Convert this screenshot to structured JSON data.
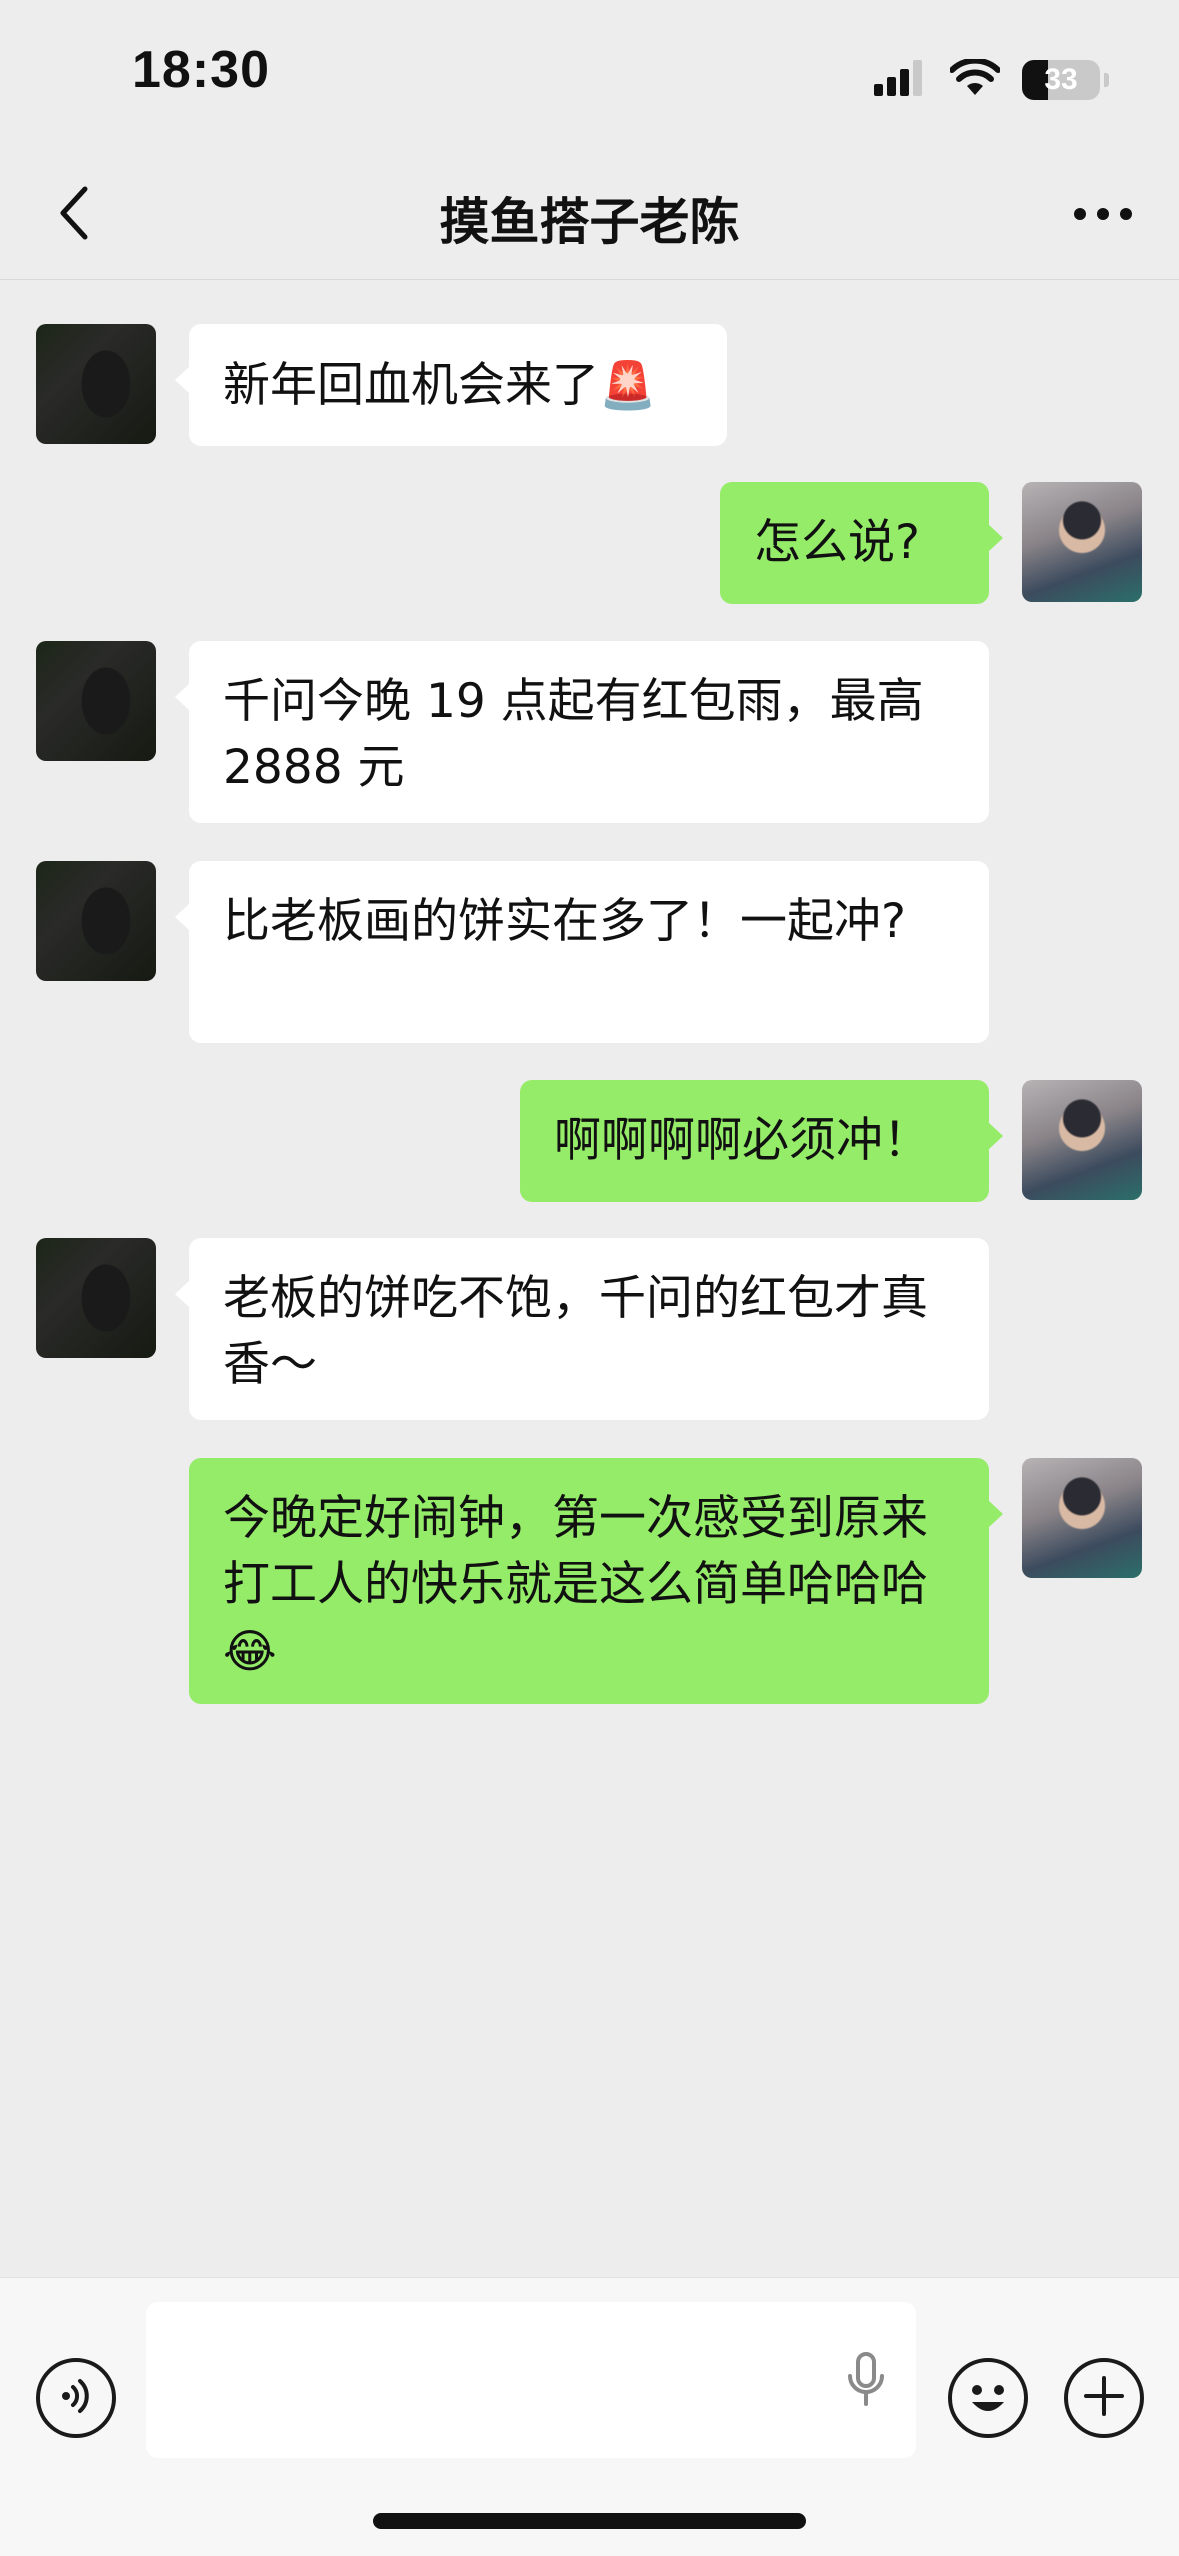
{
  "status_bar": {
    "time": "18:30",
    "battery_level": "33",
    "battery_fraction": 0.33,
    "icons": [
      "cellular-signal-icon",
      "wifi-icon",
      "battery-icon"
    ]
  },
  "nav": {
    "title": "摸鱼搭子老陈",
    "back_icon": "chevron-left-icon",
    "more_icon": "ellipsis-icon"
  },
  "messages": [
    {
      "side": "in",
      "text": "新年回血机会来了",
      "emoji": "🚨"
    },
    {
      "side": "out",
      "text": "怎么说?"
    },
    {
      "side": "in",
      "text": "千问今晚 19 点起有红包雨，最高 2888 元"
    },
    {
      "side": "in",
      "text": "比老板画的饼实在多了！一起冲?"
    },
    {
      "side": "out",
      "text": "啊啊啊啊必须冲！"
    },
    {
      "side": "in",
      "text": "老板的饼吃不饱，千问的红包才真香～"
    },
    {
      "side": "out",
      "text": "今晚定好闹钟，第一次感受到原来打工人的快乐就是这么简单哈哈哈",
      "emoji": "😂"
    }
  ],
  "input_bar": {
    "placeholder": "",
    "icons": [
      "voice-icon",
      "microphone-icon",
      "emoji-face-icon",
      "plus-icon"
    ]
  },
  "colors": {
    "background": "#ededed",
    "incoming_bubble": "#ffffff",
    "outgoing_bubble": "#95ec69",
    "input_bar": "#f7f7f7"
  }
}
